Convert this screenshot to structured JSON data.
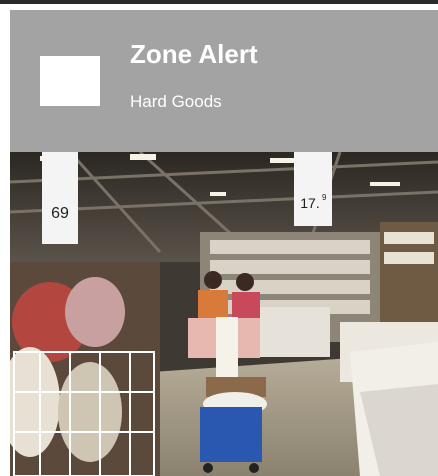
{
  "window": {
    "card_color": "#a3a3a3",
    "text_color": "#ffffff"
  },
  "alert": {
    "title": "Zone Alert",
    "subtitle": "Hard Goods",
    "thumbnail_color": "#ffffff"
  },
  "photo": {
    "sign_left_price": "69",
    "sign_right_price": "17.",
    "sign_right_price_sup": "9"
  }
}
